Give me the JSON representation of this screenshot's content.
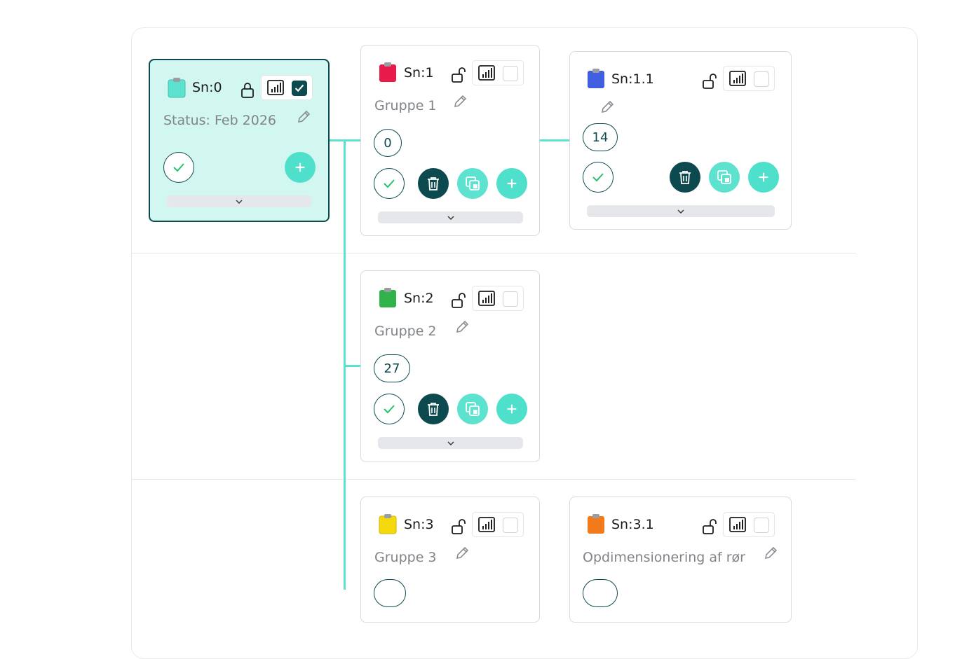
{
  "colors": {
    "accent": "#5ee2d0",
    "dark": "#0d4a4f",
    "root_bg": "#d2f7f0"
  },
  "icons": {
    "clipboard": "clipboard-icon",
    "lock": "lock-icon",
    "unlock": "unlock-icon",
    "chart": "signal-bars-icon",
    "pencil": "pencil-icon",
    "check": "check-icon",
    "trash": "trash-icon",
    "copy": "copy-icon",
    "add": "plus-icon",
    "chevron": "chevron-down-icon"
  },
  "cards": [
    {
      "id": "sn0",
      "label": "Sn:0",
      "title": "Status: Feb 2026",
      "clip_color": "#5ee2d0",
      "locked": true,
      "checked": true
    },
    {
      "id": "sn1",
      "label": "Sn:1",
      "title": "Gruppe 1",
      "count": "0",
      "clip_color": "#e8194b",
      "locked": false,
      "checked": false
    },
    {
      "id": "sn1_1",
      "label": "Sn:1.1",
      "title": "",
      "count": "14",
      "clip_color": "#3f5fe0",
      "locked": false,
      "checked": false
    },
    {
      "id": "sn2",
      "label": "Sn:2",
      "title": "Gruppe 2",
      "count": "27",
      "clip_color": "#2fb34a",
      "locked": false,
      "checked": false
    },
    {
      "id": "sn3",
      "label": "Sn:3",
      "title": "Gruppe 3",
      "clip_color": "#f5d90f",
      "locked": false,
      "checked": false
    },
    {
      "id": "sn3_1",
      "label": "Sn:3.1",
      "title": "Opdimensionering af rør",
      "clip_color": "#f27a1a",
      "locked": false,
      "checked": false
    }
  ]
}
